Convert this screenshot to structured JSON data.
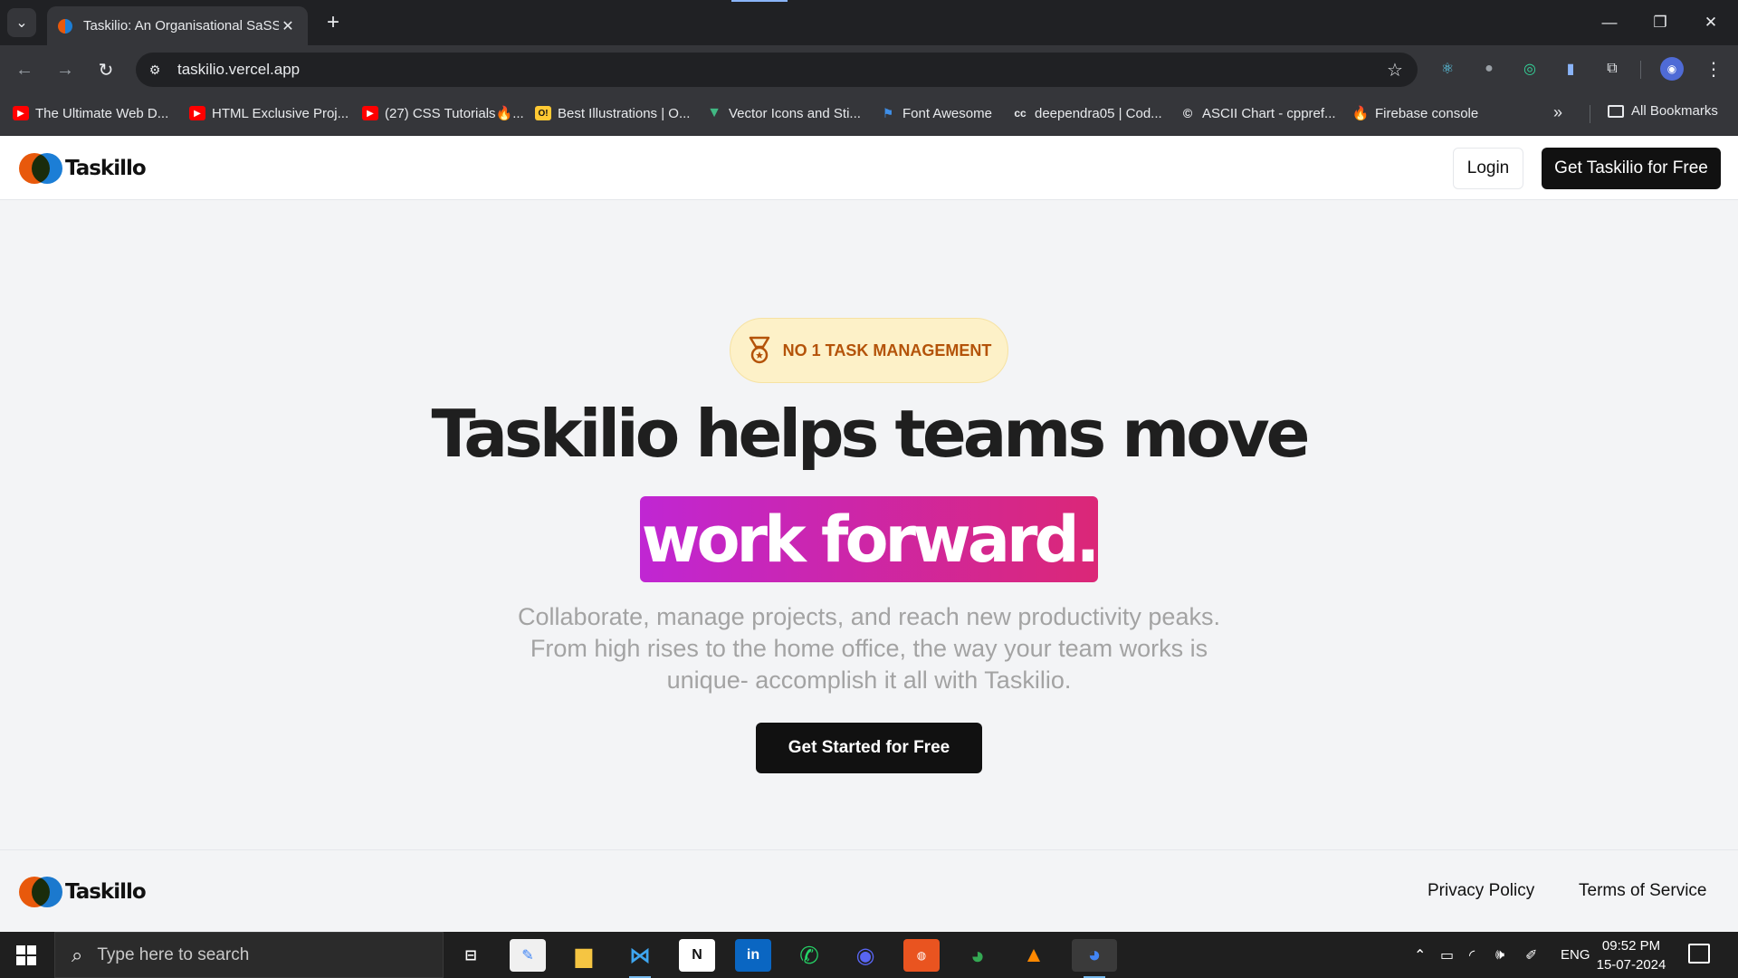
{
  "browser": {
    "tab_title": "Taskilio: An Organisational SaSS",
    "url": "taskilio.vercel.app",
    "bookmarks": [
      {
        "label": "The Ultimate Web D...",
        "icon": "youtube-icon"
      },
      {
        "label": "HTML Exclusive Proj...",
        "icon": "youtube-icon"
      },
      {
        "label": "(27) CSS Tutorials🔥...",
        "icon": "youtube-icon"
      },
      {
        "label": "Best Illustrations | O...",
        "icon": "o-icon"
      },
      {
        "label": "Vector Icons and Sti...",
        "icon": "vue-icon"
      },
      {
        "label": "Font Awesome",
        "icon": "flag-icon"
      },
      {
        "label": "deependra05 | Cod...",
        "icon": "cc-icon"
      },
      {
        "label": "ASCII Chart - cppref...",
        "icon": "cppreference-icon"
      },
      {
        "label": "Firebase console",
        "icon": "firebase-icon"
      }
    ],
    "all_bookmarks": "All Bookmarks"
  },
  "site": {
    "logo_text": "Taskillo",
    "nav": {
      "login": "Login",
      "cta": "Get Taskilio for Free"
    },
    "hero": {
      "badge": "NO 1 TASK MANAGEMENT",
      "headline": "Taskilio helps teams move",
      "highlight": "work forward.",
      "subtext_lines": [
        "Collaborate, manage projects, and reach new productivity peaks.",
        "From high rises to the home office, the way your team works is",
        "unique- accomplish it all with Taskilio."
      ],
      "cta": "Get Started for Free"
    },
    "footer": {
      "logo_text": "Taskillo",
      "privacy": "Privacy Policy",
      "terms": "Terms of Service"
    },
    "colors": {
      "accent_gradient_start": "#c026d3",
      "accent_gradient_end": "#db2777",
      "badge_bg": "#fdf1c8",
      "badge_text": "#b45309",
      "logo_orange": "#e8590c",
      "logo_blue": "#1c7ed6"
    }
  },
  "taskbar": {
    "search_placeholder": "Type here to search",
    "language": "ENG",
    "time": "09:52 PM",
    "date": "15-07-2024"
  }
}
